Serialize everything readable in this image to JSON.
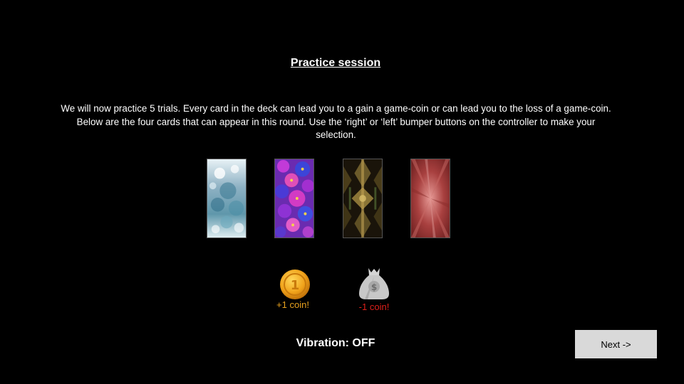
{
  "screen": {
    "title": "Practice session",
    "instructions": "We will now practice 5 trials. Every card in the deck can lead you to a gain a game-coin or can lead you to the loss of a game-coin. Below are the four cards that can appear in this round.  Use the ‘right’ or ‘left’ bumper buttons on the controller to make your selection.",
    "vibration_status": "Vibration: OFF"
  },
  "cards": [
    {
      "name": "blue-ice-card"
    },
    {
      "name": "purple-flower-card"
    },
    {
      "name": "gold-fractal-card"
    },
    {
      "name": "red-burst-card"
    }
  ],
  "outcomes": {
    "gain": {
      "icon": "gold-coin-icon",
      "label": "+1 coin!",
      "color": "#e8a21e"
    },
    "loss": {
      "icon": "money-bag-icon",
      "label": "-1 coin!",
      "color": "#e0201a"
    }
  },
  "navigation": {
    "next_label": "Next ->"
  }
}
